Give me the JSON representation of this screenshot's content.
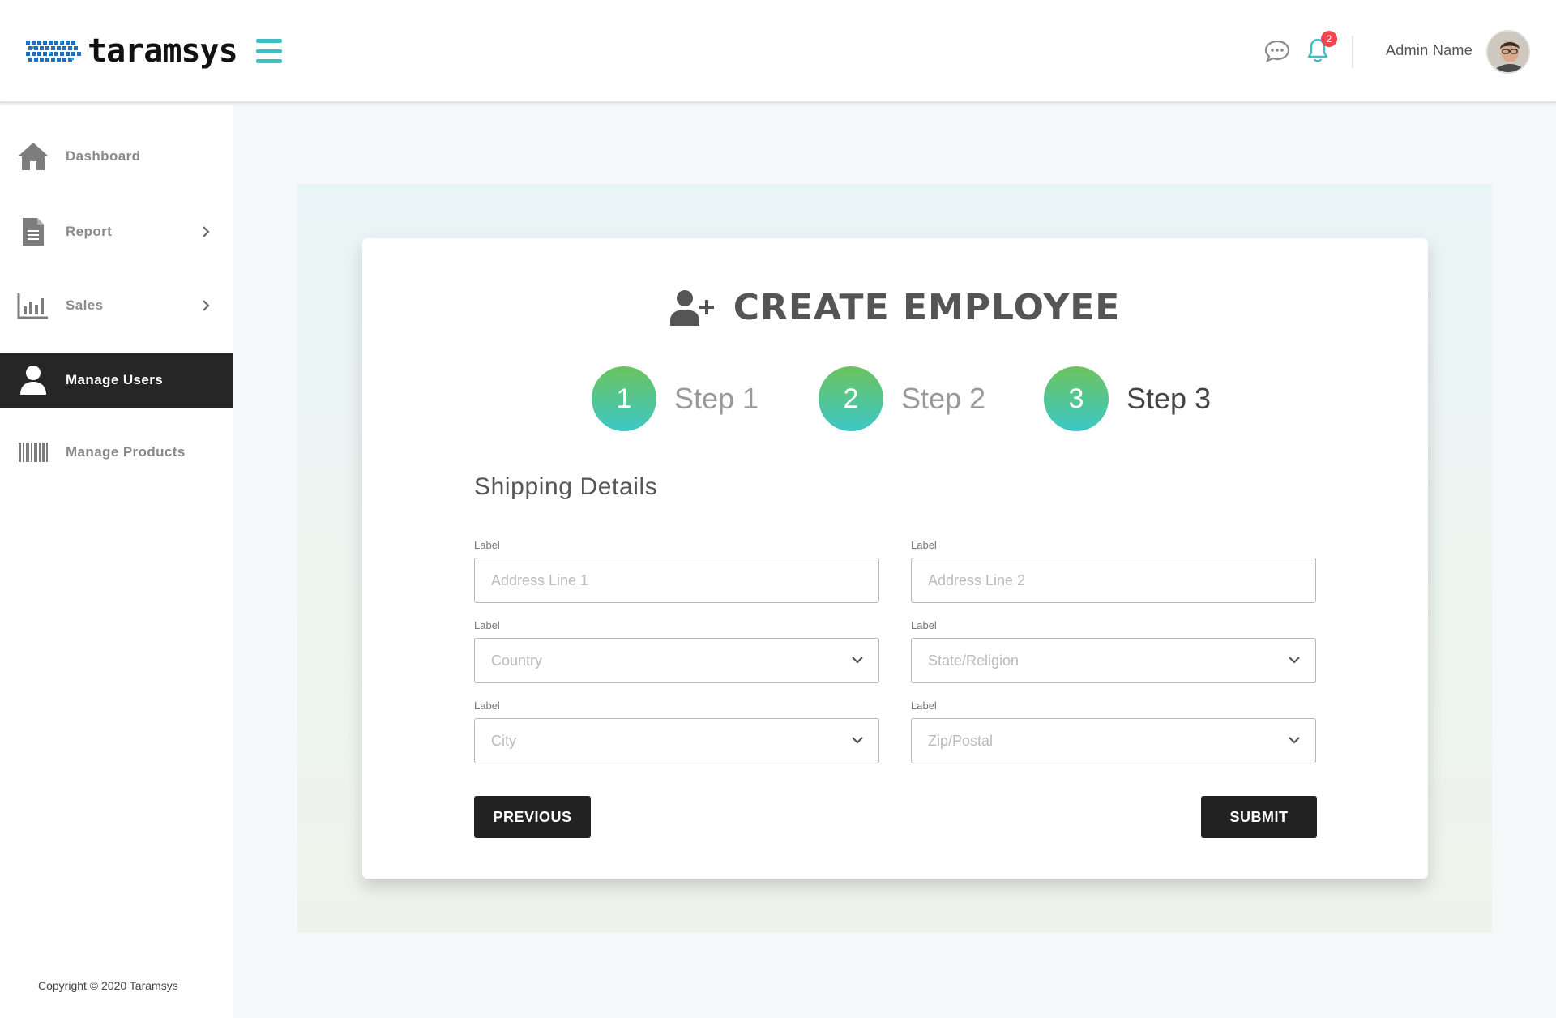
{
  "brand": {
    "name": "taramsys"
  },
  "header": {
    "notification_count": "2",
    "admin_name": "Admin Name"
  },
  "sidebar": {
    "items": [
      {
        "label": "Dashboard",
        "icon": "home-icon",
        "active": false
      },
      {
        "label": "Report",
        "icon": "document-icon",
        "active": false,
        "has_submenu": true
      },
      {
        "label": "Sales",
        "icon": "bar-chart-icon",
        "active": false,
        "has_submenu": true
      },
      {
        "label": "Manage Users",
        "icon": "user-icon",
        "active": true
      },
      {
        "label": "Manage Products",
        "icon": "barcode-icon",
        "active": false
      }
    ],
    "copyright": "Copyright © 2020 Taramsys"
  },
  "main": {
    "title": "CREATE EMPLOYEE",
    "steps": [
      {
        "number": "1",
        "label": "Step 1"
      },
      {
        "number": "2",
        "label": "Step 2"
      },
      {
        "number": "3",
        "label": "Step 3",
        "current": true
      }
    ],
    "section_title": "Shipping Details",
    "fields": [
      {
        "label": "Label",
        "placeholder": "Address Line 1",
        "type": "text"
      },
      {
        "label": "Label",
        "placeholder": "Address Line 2",
        "type": "text"
      },
      {
        "label": "Label",
        "placeholder": "Country",
        "type": "select"
      },
      {
        "label": "Label",
        "placeholder": "State/Religion",
        "type": "select"
      },
      {
        "label": "Label",
        "placeholder": "City",
        "type": "select"
      },
      {
        "label": "Label",
        "placeholder": "Zip/Postal",
        "type": "select"
      }
    ],
    "buttons": {
      "previous": "PREVIOUS",
      "submit": "SUBMIT"
    }
  },
  "colors": {
    "accent": "#3dbec4",
    "step_gradient_top": "#6cc35e",
    "step_gradient_bottom": "#3dc8c6",
    "active_nav": "#262626",
    "badge": "#f2454f"
  }
}
